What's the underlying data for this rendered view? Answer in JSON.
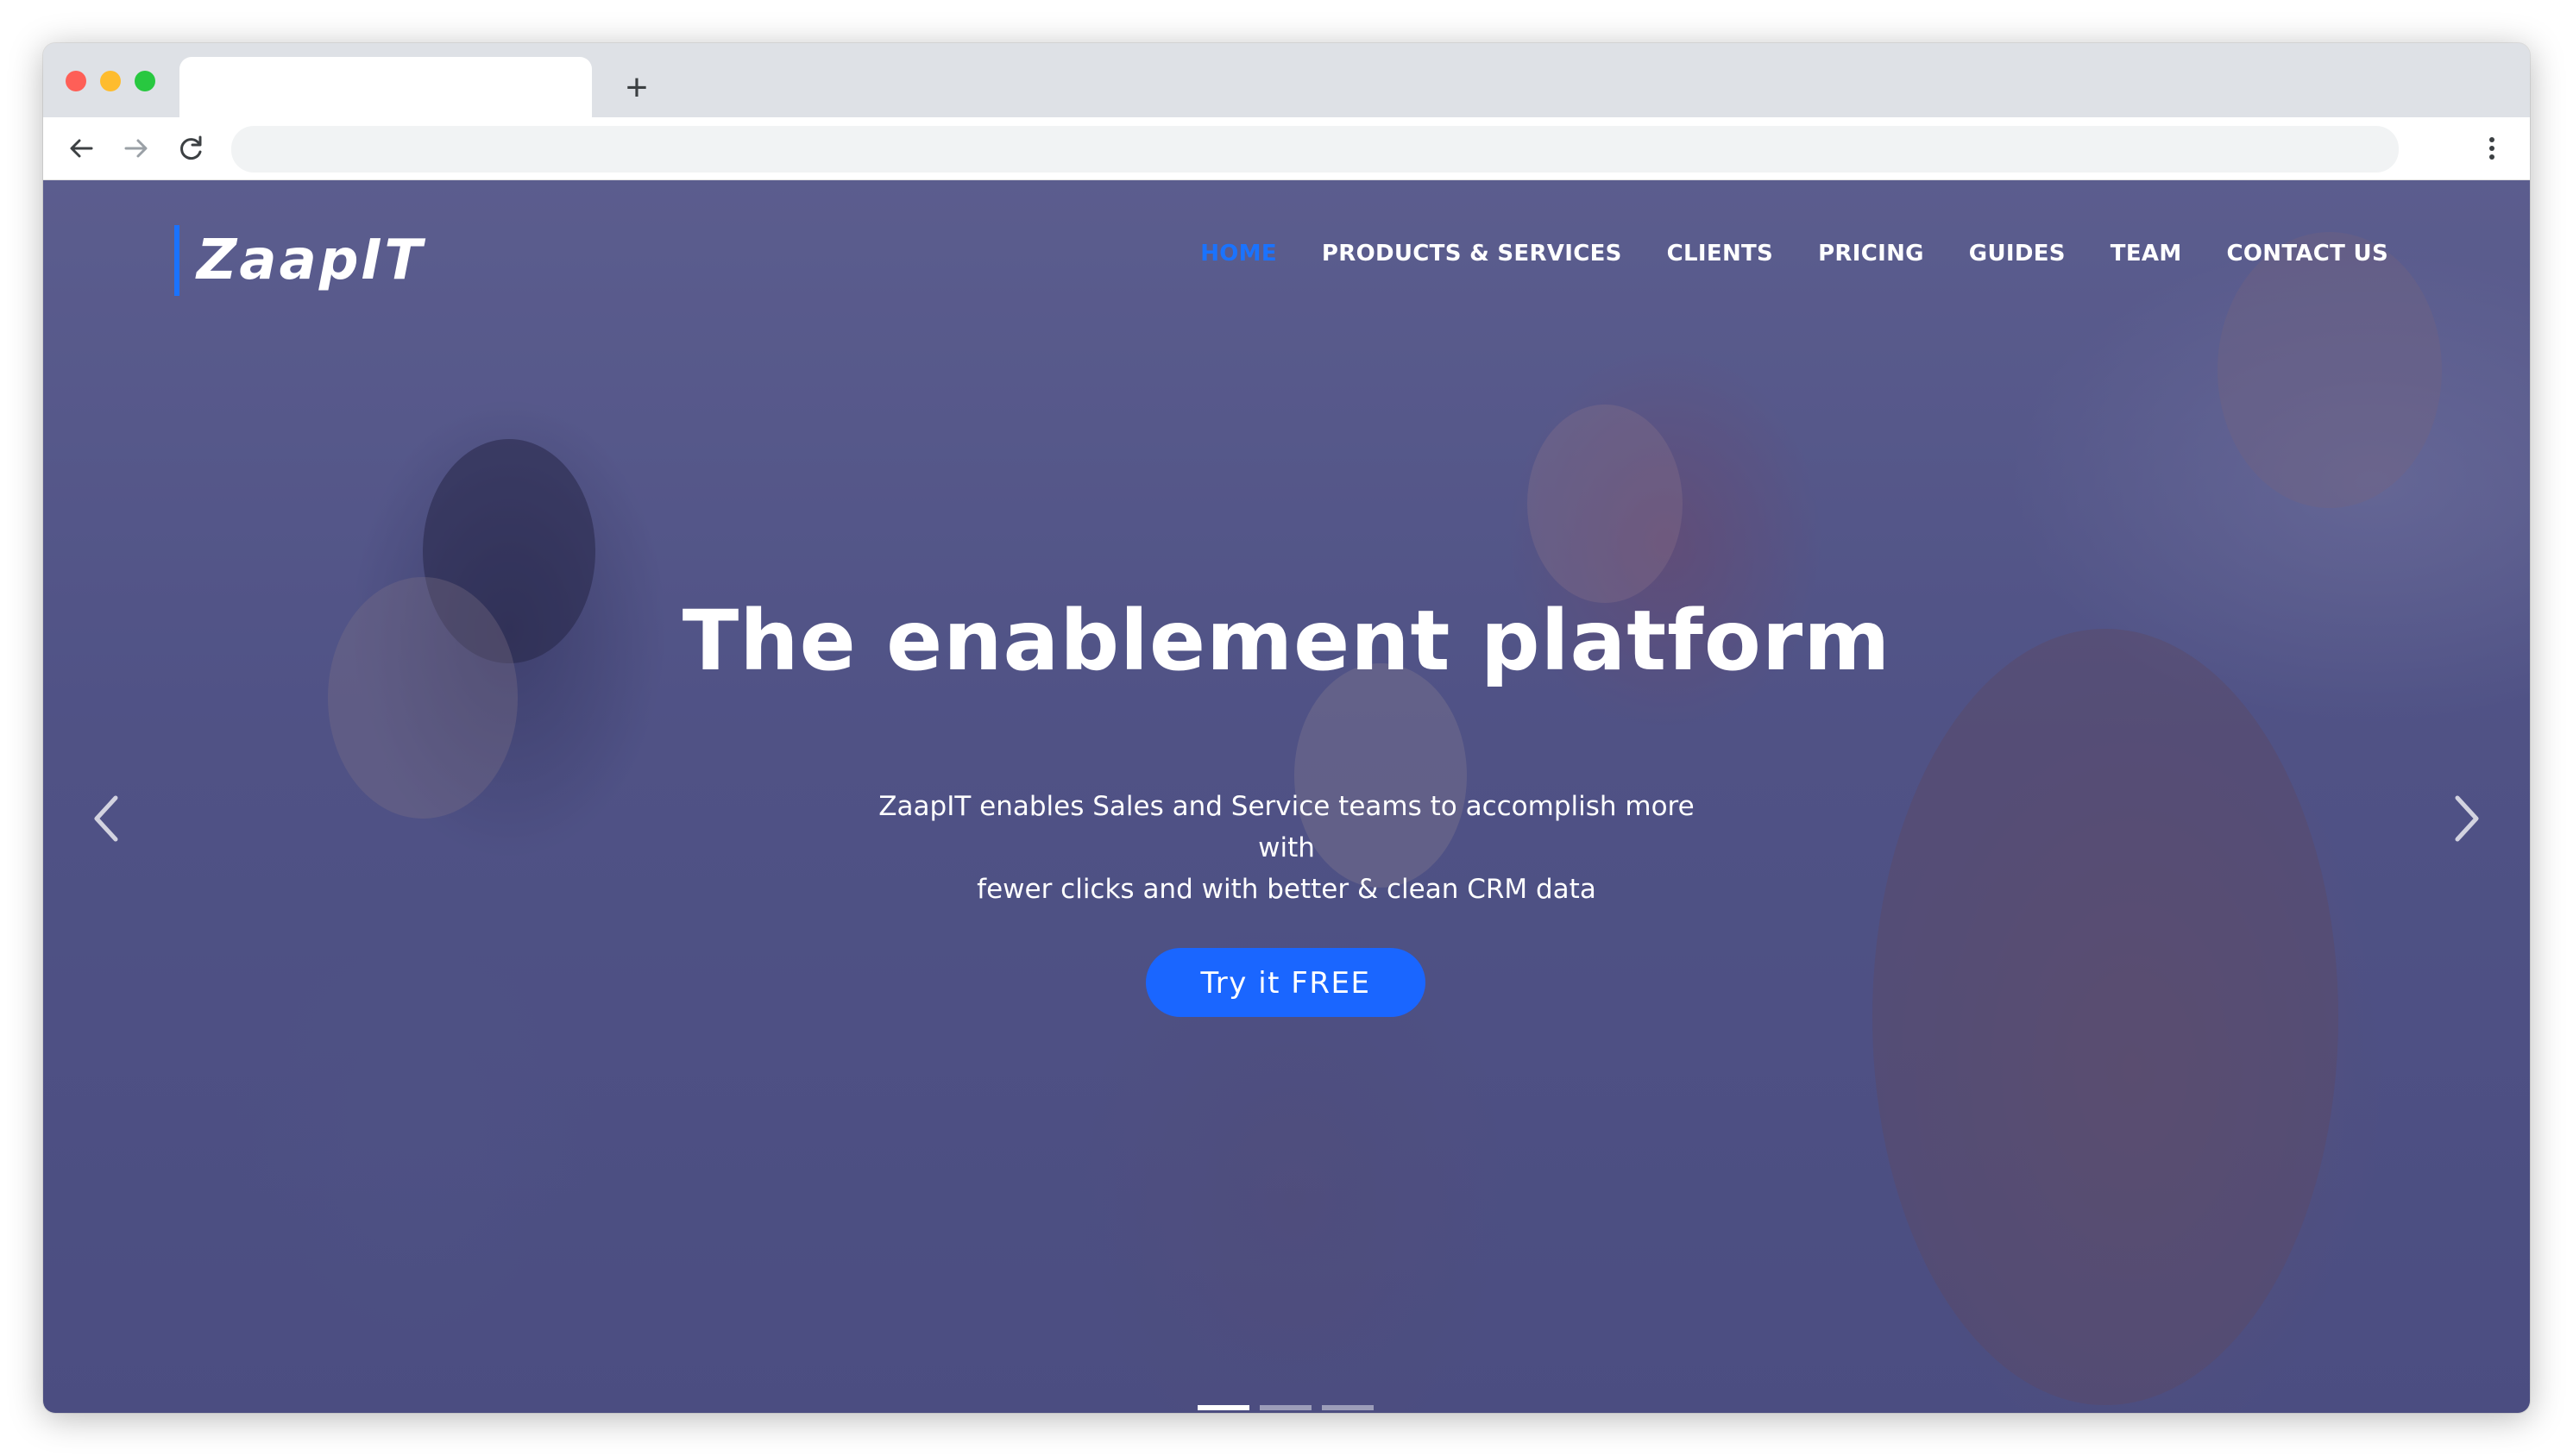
{
  "browser": {
    "tab_title": "",
    "new_tab_symbol": "+",
    "address": ""
  },
  "site": {
    "logo": "ZaapIT",
    "nav": [
      {
        "label": "HOME",
        "active": true
      },
      {
        "label": "PRODUCTS & SERVICES",
        "active": false
      },
      {
        "label": "CLIENTS",
        "active": false
      },
      {
        "label": "PRICING",
        "active": false
      },
      {
        "label": "GUIDES",
        "active": false
      },
      {
        "label": "TEAM",
        "active": false
      },
      {
        "label": "CONTACT US",
        "active": false
      }
    ],
    "hero": {
      "title": "The enablement platform",
      "subtitle_line1": "ZaapIT enables Sales and Service teams to accomplish more with",
      "subtitle_line2": "fewer clicks and with better & clean CRM data",
      "cta": "Try it FREE"
    },
    "carousel": {
      "slide_count": 3,
      "active_slide": 1
    }
  },
  "colors": {
    "accent": "#1a73ff",
    "button": "#1a66ff",
    "overlay": "#3a3c78"
  },
  "icons": [
    "back-arrow-icon",
    "forward-arrow-icon",
    "reload-icon",
    "more-vert-icon",
    "chevron-left-icon",
    "chevron-right-icon"
  ]
}
